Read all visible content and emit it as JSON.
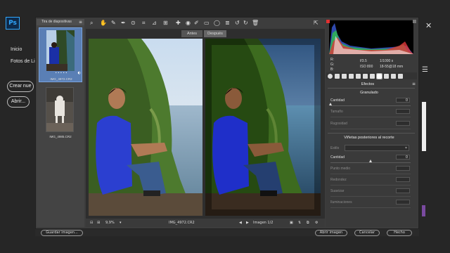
{
  "background_app": {
    "logo_text": "Ps",
    "nav": [
      "Inicio",
      "Fotos de Li"
    ],
    "buttons": [
      "Crear nue",
      "Abrir..."
    ]
  },
  "filmstrip": {
    "title": "Tira de diapositivas",
    "items": [
      {
        "filename": "IMG_4972.CR2",
        "selected": true,
        "rating": "• • • • •"
      },
      {
        "filename": "IMG_4985.CR2",
        "selected": false
      }
    ]
  },
  "preview": {
    "tabs": [
      "Antes",
      "Después"
    ],
    "zoom": "9,9%",
    "filename": "IMG_4972.CR2",
    "image_counter": "Imagen 1/2"
  },
  "info": {
    "r_label": "R:",
    "g_label": "G:",
    "b_label": "B:",
    "aperture": "f/3.5",
    "shutter": "1/1000 s",
    "iso": "ISO 800",
    "lens": "18-55@18 mm"
  },
  "panel": {
    "title": "Efectos",
    "grain": {
      "title": "Granulado",
      "amount_label": "Cantidad",
      "amount_value": "0",
      "size_label": "Tamaño",
      "roughness_label": "Rugosidad"
    },
    "vignette": {
      "title": "Viñetas posteriores al recorte",
      "style_label": "Estilo",
      "amount_label": "Cantidad",
      "amount_value": "0",
      "midpoint_label": "Punto medio",
      "roundness_label": "Redondez",
      "feather_label": "Suavizar",
      "highlights_label": "Iluminaciones"
    }
  },
  "bottom_bar": {
    "left_button": "Guardar imagen...",
    "right_buttons": [
      "Abrir imagen",
      "Cancelar",
      "Hecho"
    ]
  },
  "colors": {
    "accent": "#31a8ff",
    "selection": "#5a7fb5"
  }
}
